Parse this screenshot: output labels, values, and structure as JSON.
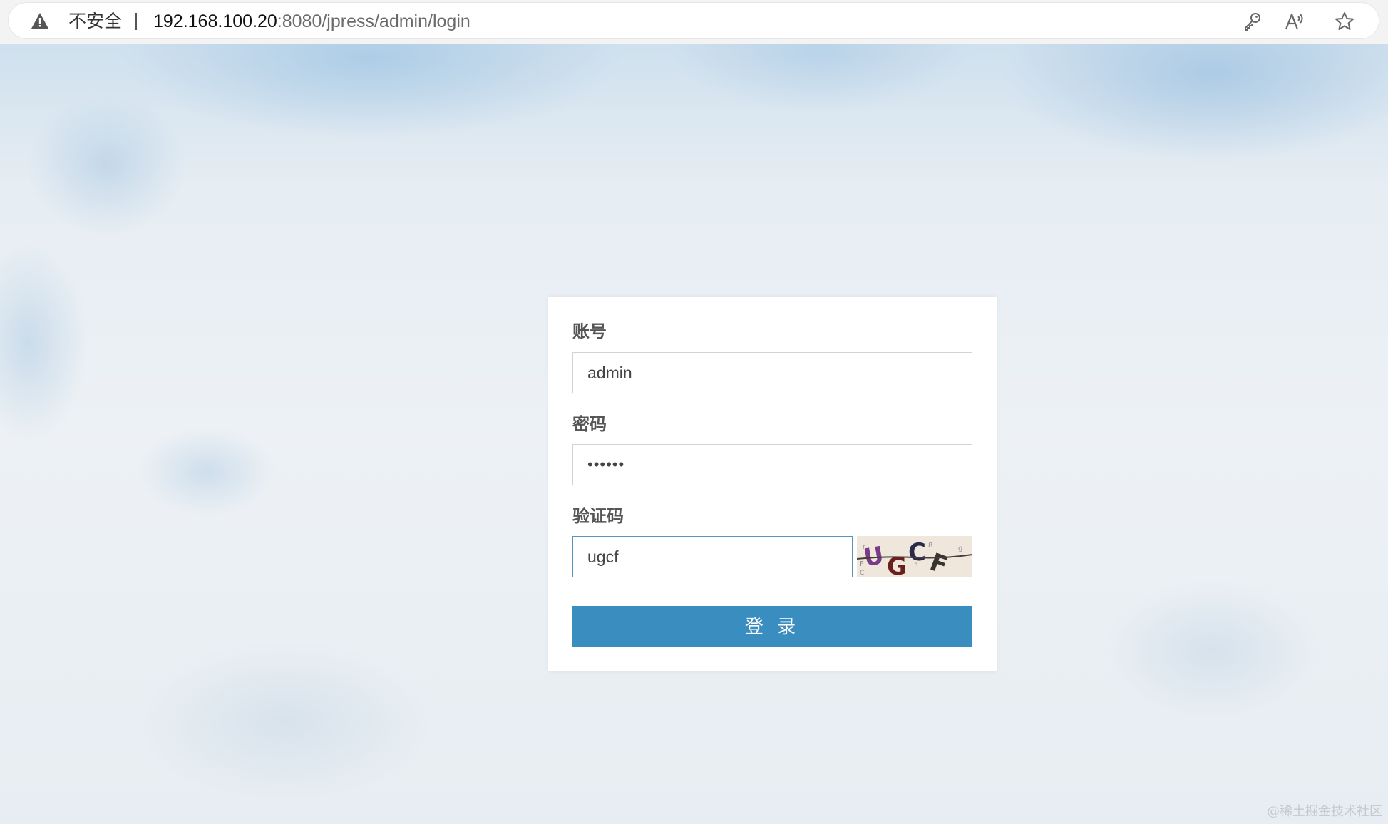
{
  "browser": {
    "security_label": "不安全",
    "url_host": "192.168.100.20",
    "url_rest": ":8080/jpress/admin/login",
    "icons": [
      "warning-triangle-icon",
      "key-icon",
      "read-aloud-icon",
      "favorite-star-icon"
    ]
  },
  "login": {
    "account_label": "账号",
    "account_value": "admin",
    "password_label": "密码",
    "password_value": "••••••",
    "captcha_label": "验证码",
    "captcha_value": "ugcf",
    "captcha_image_text": "UGCF",
    "submit_label": "登 录"
  },
  "watermark": "@稀土掘金技术社区",
  "colors": {
    "button": "#3a8ebf",
    "focused_border": "#5a94bd"
  }
}
